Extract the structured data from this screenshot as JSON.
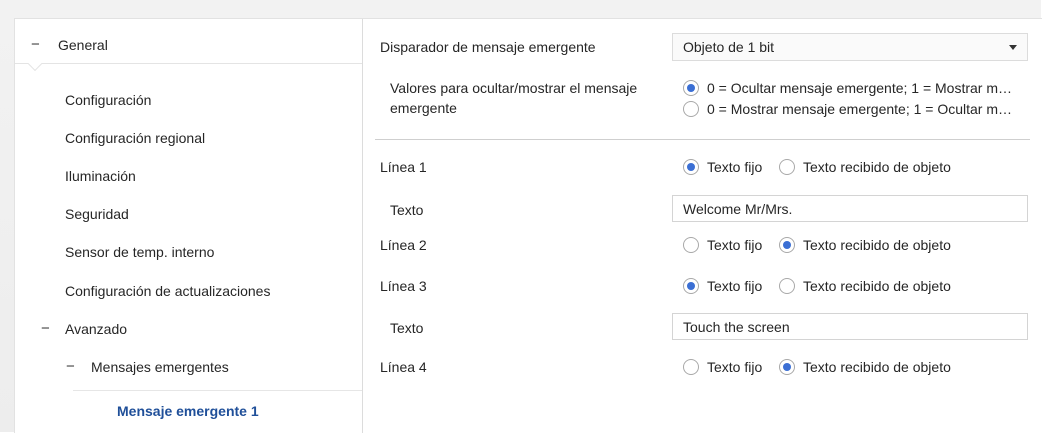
{
  "sidebar": {
    "general": "General",
    "items": [
      "Configuración",
      "Configuración regional",
      "Iluminación",
      "Seguridad",
      "Sensor de temp. interno",
      "Configuración de actualizaciones"
    ],
    "avanzado": "Avanzado",
    "mensajes": "Mensajes emergentes",
    "active": "Mensaje emergente 1"
  },
  "main": {
    "trigger_label": "Disparador de mensaje emergente",
    "trigger_value": "Objeto de 1 bit",
    "values_label_line1": "Valores para ocultar/mostrar el mensaje",
    "values_label_line2": "emergente",
    "values_options": [
      "0 = Ocultar mensaje emergente; 1 = Mostrar m…",
      "0 = Mostrar mensaje emergente; 1 = Ocultar m…"
    ],
    "values_selected": 0,
    "text_fixed": "Texto fijo",
    "text_object": "Texto recibido de objeto",
    "text_label": "Texto",
    "lines": [
      {
        "label": "Línea 1",
        "mode": "fixed",
        "text": "Welcome Mr/Mrs."
      },
      {
        "label": "Línea 2",
        "mode": "object"
      },
      {
        "label": "Línea 3",
        "mode": "fixed",
        "text": "Touch the screen"
      },
      {
        "label": "Línea 4",
        "mode": "object"
      }
    ]
  },
  "colors": {
    "accent": "#3b6fd4",
    "active_text": "#1f4f99"
  }
}
